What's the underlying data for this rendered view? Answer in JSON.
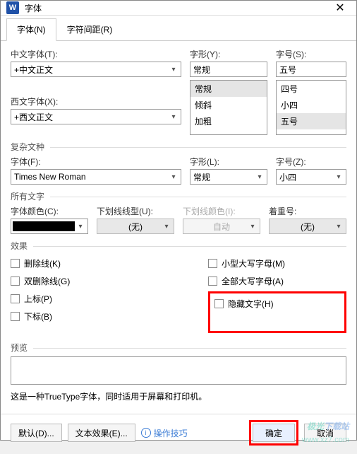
{
  "titlebar": {
    "icon_letter": "W",
    "title": "字体"
  },
  "tabs": {
    "font": "字体(N)",
    "spacing": "字符间距(R)"
  },
  "labels": {
    "cn_font": "中文字体(T):",
    "style": "字形(Y):",
    "size": "字号(S):",
    "west_font": "西文字体(X):",
    "complex_group": "复杂文种",
    "font_f": "字体(F):",
    "style_l": "字形(L):",
    "size_z": "字号(Z):",
    "all_text": "所有文字",
    "font_color": "字体颜色(C):",
    "underline_style": "下划线线型(U):",
    "underline_color": "下划线颜色(I):",
    "emphasis": "着重号:",
    "effects": "效果",
    "preview": "预览"
  },
  "values": {
    "cn_font": "+中文正文",
    "style": "常规",
    "size": "五号",
    "west_font": "+西文正文",
    "font_f": "Times New Roman",
    "style_l": "常规",
    "size_z": "小四",
    "underline_none": "(无)",
    "underline_color": "自动",
    "emphasis_none": "(无)"
  },
  "style_list": [
    "常规",
    "倾斜",
    "加粗"
  ],
  "size_list": [
    "四号",
    "小四",
    "五号"
  ],
  "effects": {
    "strike": "删除线(K)",
    "dstrike": "双删除线(G)",
    "super": "上标(P)",
    "sub": "下标(B)",
    "smallcaps": "小型大写字母(M)",
    "allcaps": "全部大写字母(A)",
    "hidden": "隐藏文字(H)"
  },
  "info": "这是一种TrueType字体，同时适用于屏幕和打印机。",
  "footer": {
    "default": "默认(D)...",
    "text_effects": "文本效果(E)...",
    "tips": "操作技巧",
    "ok": "确定",
    "cancel": "取消"
  },
  "watermark": {
    "brand": "极光下载站",
    "url": "www.xz7.com"
  }
}
